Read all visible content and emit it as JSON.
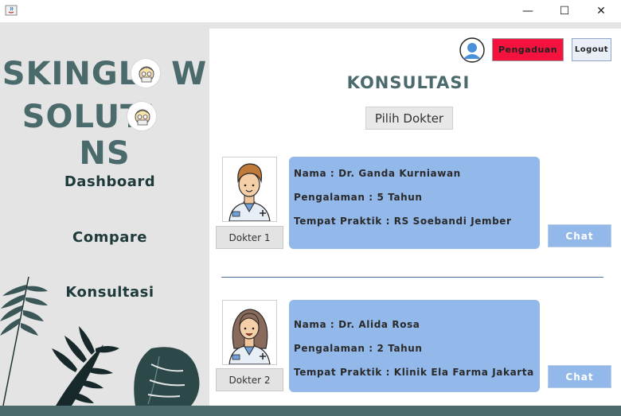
{
  "window": {
    "minimize_glyph": "—",
    "maximize_glyph": "☐",
    "close_glyph": "✕"
  },
  "sidebar": {
    "brand_line1_a": "SKINGL",
    "brand_line1_b": "W",
    "brand_line2_a": "SOLUTI",
    "brand_line2_b": "NS",
    "nav": [
      {
        "label": "Dashboard"
      },
      {
        "label": "Compare"
      },
      {
        "label": "Konsultasi"
      }
    ]
  },
  "header": {
    "complaint_label": "Pengaduan",
    "logout_label": "Logout",
    "title": "KONSULTASI",
    "pick_doctor_label": "Pilih Dokter"
  },
  "doctors": [
    {
      "label": "Dokter 1",
      "name": "Nama : Dr. Ganda Kurniawan",
      "experience": "Pengalaman : 5 Tahun",
      "practice": "Tempat Praktik : RS Soebandi Jember",
      "chat_label": "Chat"
    },
    {
      "label": "Dokter 2",
      "name": "Nama : Dr. Alida Rosa",
      "experience": "Pengalaman : 2 Tahun",
      "practice": "Tempat Praktik : Klinik Ela Farma Jakarta",
      "chat_label": "Chat"
    }
  ],
  "colors": {
    "brand_teal": "#4a6a6b",
    "complaint_red": "#f5123f",
    "card_blue": "#93b8ea"
  }
}
